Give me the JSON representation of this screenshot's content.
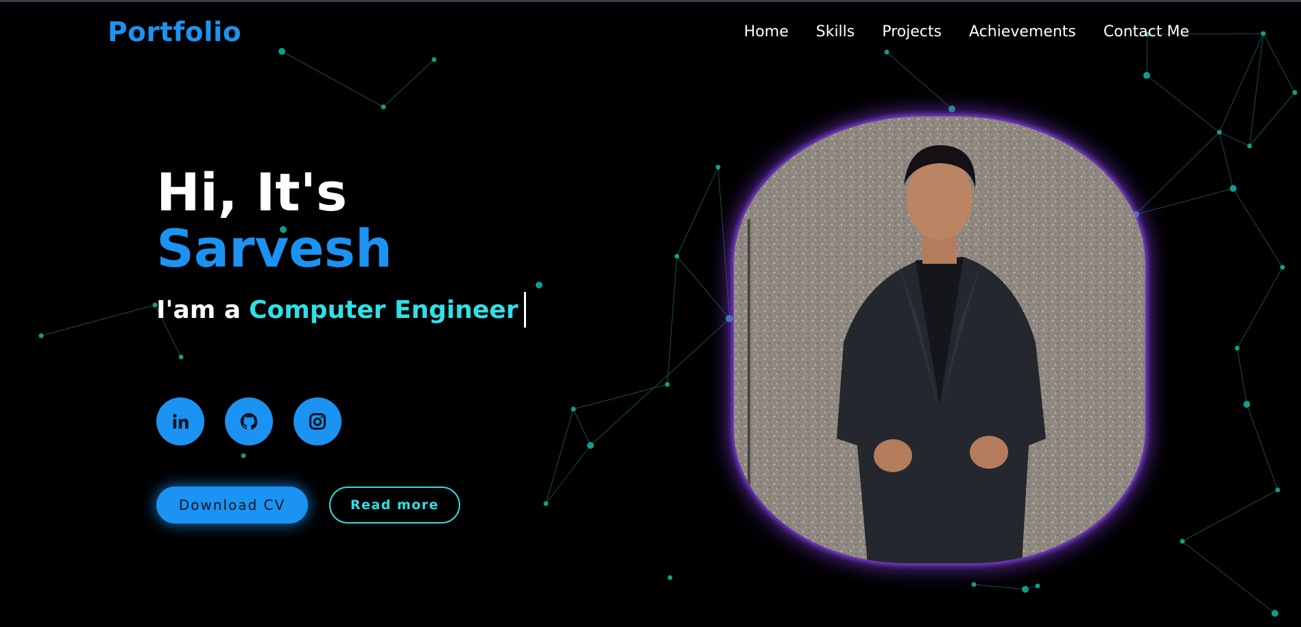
{
  "header": {
    "logo": "Portfolio",
    "nav": [
      "Home",
      "Skills",
      "Projects",
      "Achievements",
      "Contact Me"
    ]
  },
  "hero": {
    "greeting": "Hi, It's",
    "name": "Sarvesh",
    "role_prefix": "I'am a",
    "role_typed": "Computer Engineer"
  },
  "socials": [
    {
      "name": "linkedin",
      "icon": "linkedin-icon"
    },
    {
      "name": "github",
      "icon": "github-icon"
    },
    {
      "name": "instagram",
      "icon": "instagram-icon"
    }
  ],
  "buttons": {
    "download_cv": "Download CV",
    "read_more": "Read more"
  },
  "colors": {
    "accent_blue": "#1b93f2",
    "accent_cyan": "#2fe0e6",
    "photo_glow": "#823ce6",
    "particle": "#139c8c",
    "background": "#000000"
  }
}
